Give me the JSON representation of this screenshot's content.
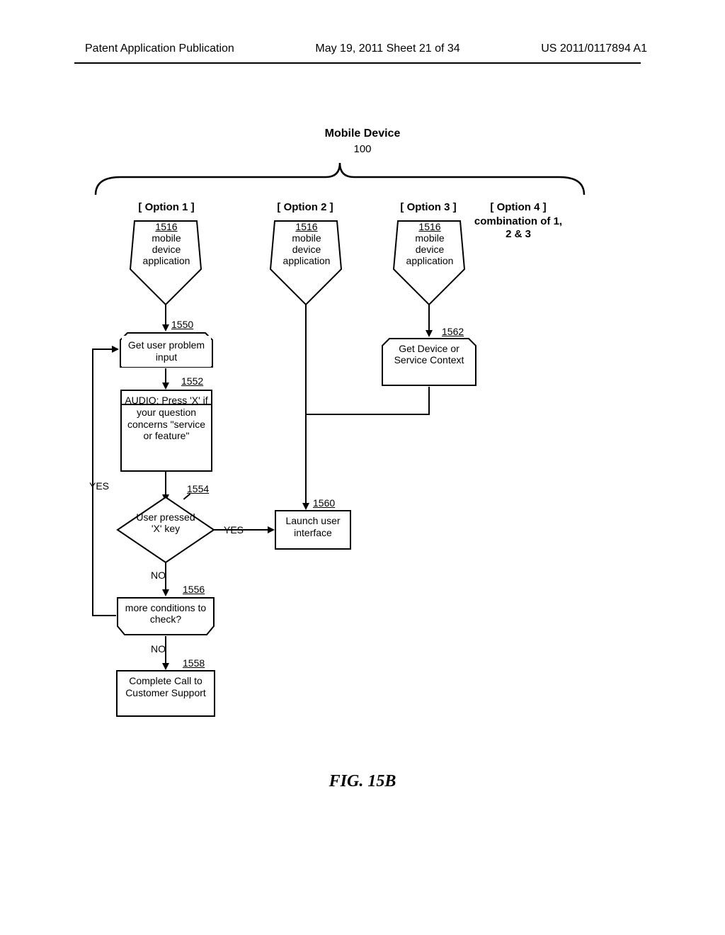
{
  "header": {
    "left": "Patent Application Publication",
    "center": "May 19, 2011  Sheet 21 of 34",
    "right": "US 2011/0117894 A1"
  },
  "top_title": "Mobile Device",
  "top_ref": "100",
  "options": {
    "opt1": "[ Option 1 ]",
    "opt2": "[ Option 2 ]",
    "opt3": "[ Option 3 ]",
    "opt4": "[ Option 4 ]",
    "opt4_sub": "combination of 1, 2 & 3"
  },
  "app": {
    "ref": "1516",
    "line1": "mobile",
    "line2": "device",
    "line3": "application"
  },
  "n1550": {
    "ref": "1550",
    "text": "Get user problem input"
  },
  "n1552": {
    "ref": "1552",
    "text": "AUDIO: Press 'X' if your question concerns \"service or feature\""
  },
  "n1554": {
    "ref": "1554",
    "text": "User pressed 'X' key"
  },
  "n1556": {
    "ref": "1556",
    "text": "more conditions to check?"
  },
  "n1558": {
    "ref": "1558",
    "text": "Complete Call to Customer Support"
  },
  "n1560": {
    "ref": "1560",
    "text": "Launch user interface"
  },
  "n1562": {
    "ref": "1562",
    "text": "Get Device or Service Context"
  },
  "labels": {
    "yes": "YES",
    "no": "NO"
  },
  "figure": "FIG. 15B"
}
